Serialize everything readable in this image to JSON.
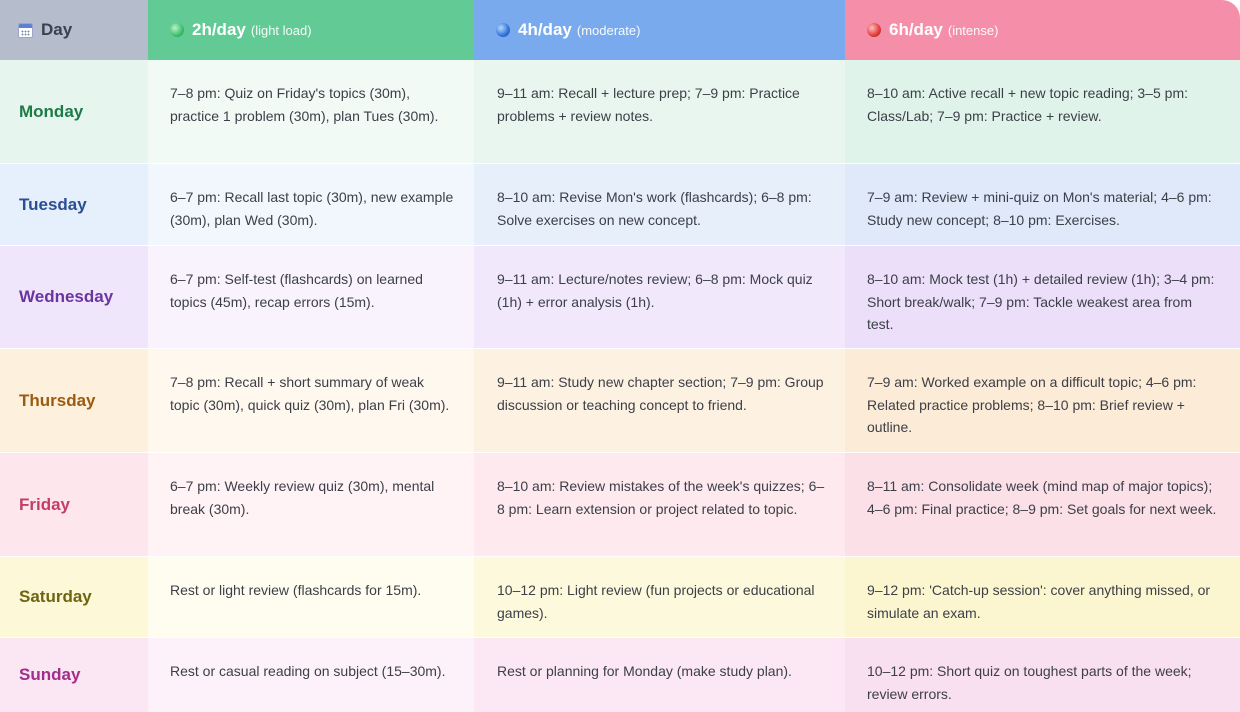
{
  "header": {
    "day": "Day",
    "col2": {
      "title": "2h/day",
      "sub": "(light load)"
    },
    "col4": {
      "title": "4h/day",
      "sub": "(moderate)"
    },
    "col6": {
      "title": "6h/day",
      "sub": "(intense)"
    }
  },
  "rows": [
    {
      "day": "Monday",
      "light": "7–8 pm: Quiz on Friday's topics (30m), practice 1 problem (30m), plan Tues (30m).",
      "moderate": "9–11 am: Recall + lecture prep; 7–9 pm: Practice problems + review notes.",
      "intense": "8–10 am: Active recall + new topic reading; 3–5 pm: Class/Lab; 7–9 pm: Practice + review."
    },
    {
      "day": "Tuesday",
      "light": "6–7 pm: Recall last topic (30m), new example (30m), plan Wed (30m).",
      "moderate": "8–10 am: Revise Mon's work (flashcards); 6–8 pm: Solve exercises on new concept.",
      "intense": "7–9 am: Review + mini-quiz on Mon's material; 4–6 pm: Study new concept; 8–10 pm: Exercises."
    },
    {
      "day": "Wednesday",
      "light": "6–7 pm: Self-test (flashcards) on learned topics (45m), recap errors (15m).",
      "moderate": "9–11 am: Lecture/notes review; 6–8 pm: Mock quiz (1h) + error analysis (1h).",
      "intense": "8–10 am: Mock test (1h) + detailed review (1h); 3–4 pm: Short break/walk; 7–9 pm: Tackle weakest area from test."
    },
    {
      "day": "Thursday",
      "light": "7–8 pm: Recall + short summary of weak topic (30m), quick quiz (30m), plan Fri (30m).",
      "moderate": "9–11 am: Study new chapter section; 7–9 pm: Group discussion or teaching concept to friend.",
      "intense": "7–9 am: Worked example on a difficult topic; 4–6 pm: Related practice problems; 8–10 pm: Brief review + outline."
    },
    {
      "day": "Friday",
      "light": "6–7 pm: Weekly review quiz (30m), mental break (30m).",
      "moderate": "8–10 am: Review mistakes of the week's quizzes; 6–8 pm: Learn extension or project related to topic.",
      "intense": "8–11 am: Consolidate week (mind map of major topics); 4–6 pm: Final practice; 8–9 pm: Set goals for next week."
    },
    {
      "day": "Saturday",
      "light": "Rest or light review (flashcards for 15m).",
      "moderate": "10–12 pm: Light review (fun projects or educational games).",
      "intense": "9–12 pm: 'Catch-up session': cover anything missed, or simulate an exam."
    },
    {
      "day": "Sunday",
      "light": "Rest or casual reading on subject (15–30m).",
      "moderate": "Rest or planning for Monday (make study plan).",
      "intense": "10–12 pm: Short quiz on toughest parts of the week; review errors."
    }
  ],
  "icons": {
    "day": "calendar-icon",
    "light": "green-circle-icon",
    "moderate": "blue-circle-icon",
    "intense": "red-circle-icon"
  },
  "colors": {
    "header_day": "#b5bccb",
    "header_light": "#62ca95",
    "header_moderate": "#78aaed",
    "header_intense": "#f58fa9"
  }
}
